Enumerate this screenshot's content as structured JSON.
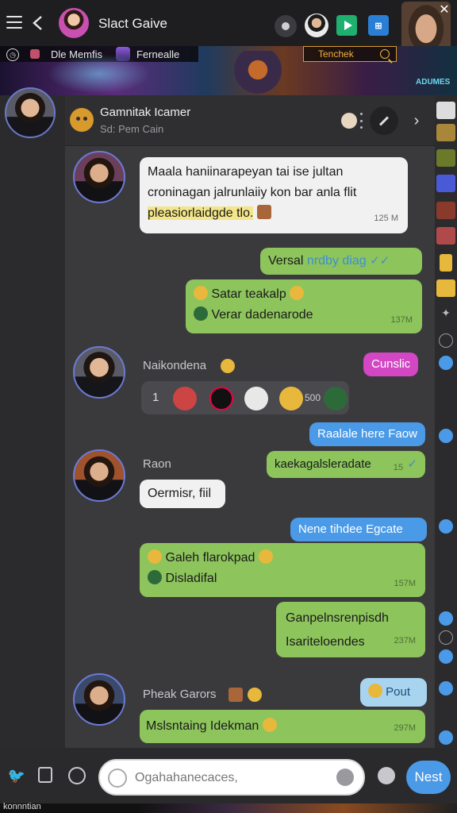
{
  "topbar": {
    "title": "Slact Gaive",
    "icons": [
      "menu-icon",
      "back-icon",
      "record-icon",
      "play-icon",
      "grid-icon",
      "close-icon"
    ]
  },
  "banner": {
    "left_label": "Dle Memfis",
    "mid_label": "Fernealle",
    "search_label": "Tenchek",
    "right_label": "ADUMES"
  },
  "chat": {
    "title": "Gamnitak Icamer",
    "subtitle": "Sd: Pem Cain"
  },
  "messages": {
    "m1": {
      "text": "Maala haniinarapeyan tai ise jultan croninagan jalrunlaiiy kon bar anla flit",
      "highlight": "pleasiorlaidgde tlo.",
      "time": "125 M"
    },
    "m2": {
      "text": "Versal",
      "link": "nrdby diag",
      "tick": "✓✓"
    },
    "m3": {
      "line1": "Satar teakalp",
      "line2": "Verar dadenarode",
      "time": "137M"
    },
    "m4": {
      "sender": "Naikondena",
      "pill": "Cunslic",
      "count_left": "1",
      "count_right": "500"
    },
    "m5": {
      "pill": "Raalale here Faow"
    },
    "m6": {
      "text": "kaekagalsleradate",
      "time": "15",
      "tick": "✓"
    },
    "m7": {
      "sender": "Raon",
      "text": "Oermisr, fiil"
    },
    "m8": {
      "pill": "Nene tihdee Egcate"
    },
    "m9": {
      "line1": "Galeh flarokpad",
      "line2": "Disladifal",
      "time": "157M"
    },
    "m10": {
      "line1": "Ganpelnsrenpisdh",
      "line2": "Isariteloendes",
      "time": "237M"
    },
    "m11": {
      "sender": "Pheak Garors",
      "pill": "Pout",
      "text": "Mslsntaing Idekman",
      "time": "297M"
    }
  },
  "composer": {
    "placeholder": "Ogahahanecaces,",
    "send_label": "Nest"
  },
  "footer": {
    "label": "konnntian"
  },
  "colors": {
    "accent": "#4a9ae8",
    "outgoing": "#8dc45c",
    "incoming": "#f1f1f1",
    "magenta": "#d346c4"
  }
}
